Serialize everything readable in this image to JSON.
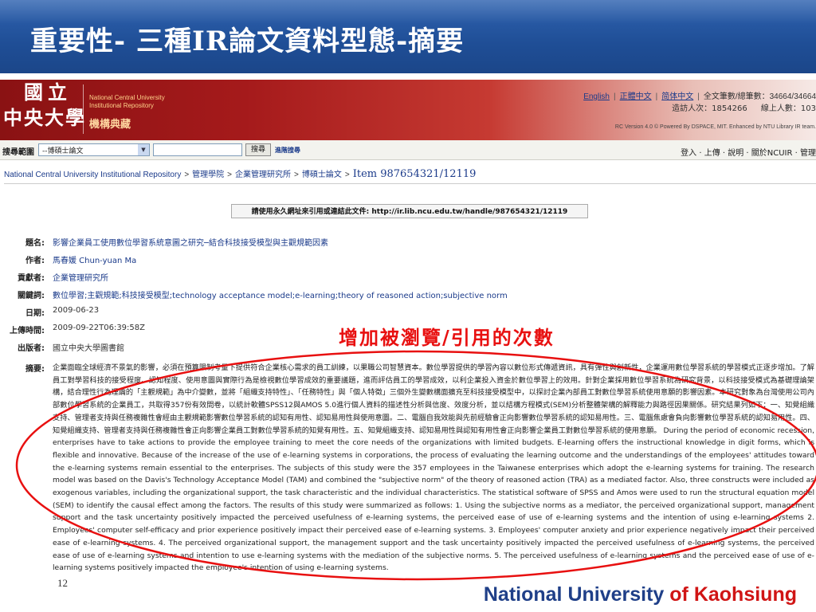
{
  "slide": {
    "title": "重要性- 三種IR論文資料型態-摘要",
    "annotation": "增加被瀏覽/引用的次數",
    "page_number": "12",
    "footer_part1": "National University",
    "footer_part2": "of Kaohsiung"
  },
  "header": {
    "logo_line1": "國立",
    "logo_line2": "中央大學",
    "logo_en1": "National Central University",
    "logo_en2": "Institutional Repository",
    "logo_sub": "機構典藏",
    "lang_english": "English",
    "lang_trad": "正體中文",
    "lang_simp": "简体中文",
    "stats_text": "全文筆數/總筆數：34664/34664",
    "visitors": "造訪人次：1854266",
    "online": "線上人數：103",
    "version": "RC Version 4.0 © Powered By DSPACE, MIT. Enhanced by NTU Library IR team."
  },
  "search": {
    "label": "搜尋範圍",
    "scope": "--博碩士論文",
    "button": "搜尋",
    "advanced": "進階搜尋",
    "right_links": "登入 · 上傳 · 說明 · 關於NCUIR · 管理"
  },
  "breadcrumb": {
    "repo": "National Central University Institutional Repository",
    "c1": "管理學院",
    "c2": "企業管理研究所",
    "c3": "博碩士論文",
    "item": "Item 987654321/12119"
  },
  "permalink": "請使用永久網址來引用或連結此文件: http://ir.lib.ncu.edu.tw/handle/987654321/12119",
  "record": {
    "title_label": "題名:",
    "title_value": "影響企業員工使用數位學習系統意圖之研究─結合科技接受模型與主觀規範因素",
    "author_label": "作者:",
    "author_value": "馬春媛 Chun-yuan Ma",
    "contrib_label": "貢獻者:",
    "contrib_value": "企業管理研究所",
    "keywords_label": "關鍵詞:",
    "keywords_value": "數位學習;主觀規範;科技接受模型;technology acceptance model;e-learning;theory of reasoned action;subjective norm",
    "date_label": "日期:",
    "date_value": "2009-06-23",
    "upload_label": "上傳時間:",
    "upload_value": "2009-09-22T06:39:58Z",
    "publisher_label": "出版者:",
    "publisher_value": "國立中央大學圖書館",
    "abstract_label": "摘要:",
    "abstract_value": "企業面臨全球經濟不景氣的影響，必須在預算限制考量下提供符合企業核心需求的員工訓練，以果職公司智慧資本。數位學習提供的學習內容以數位形式傳遞資訊，具有彈性與創新性，企業運用數位學習系統的學習模式正逐步增加。了解員工對學習科技的接受程度、認知程度、使用意圖與實際行為是檢視數位學習成效的重要議題，進而評估員工的學習成效，以利企業投入資金於數位學習上的效用。針對企業採用數位學習系統為研究背景，以科技接受模式為基礎理論架構，結合理性行為理論的「主觀規範」為中介變數，並將「組織支持特性」、「任務特性」與「個人特徵」三個外生變數構面擴充至科技接受模型中，以探討企業內部員工對數位學習系統使用意願的影響因素。本研究對象為台灣使用公司內部數位學習系統的企業員工，共取得357份有效問卷，以統計軟體SPSS12與AMOS 5.0進行個人資料的描述性分析與信度、效度分析，並以結構方程模式(SEM)分析整體架構的解釋能力與路徑因果關係。研究結果列如下：一、知覺組織支持、管理者支持與任務複雜性會經由主觀規範影響數位學習系統的認知有用性、認知易用性與使用意圖。二、電腦自我效能與先前經驗會正向影響數位學習系統的認知易用性。三、電腦焦慮會負向影響數位學習系統的認知易用性。四、知覺組織支持、管理者支持與任務複雜性會正向影響企業員工對數位學習系統的知覺有用性。五、知覺組織支持、認知易用性與認知有用性會正向影響企業員工對數位學習系統的使用意願。    During the period of economic recession, enterprises have to take actions to provide the employee training to meet the core needs of the organizations with limited budgets. E-learning offers the instructional knowledge in digit forms, which is flexible and innovative. Because of the increase of the use of e-learning systems in corporations, the process of evaluating the learning outcome and the understandings of the employees' attitudes toward the e-learning systems remain essential to the enterprises.      The subjects of this study were the 357 employees in the Taiwanese enterprises which adopt the e-learning systems for training. The research model was based on the Davis's Technology Acceptance Model (TAM) and combined the \"subjective norm\" of the theory of reasoned action (TRA) as a mediated factor. Also, three constructs were included as exogenous variables, including the organizational support, the task characteristic and the individual characteristics.      The statistical software of SPSS and Amos were used to run the structural equation model (SEM) to identify the causal effect among the factors. The results of this study were summarized as follows: 1. Using the subjective norms as a mediator, the perceived organizational support, management support and the task uncertainty positively impacted the perceived usefulness of e-learning systems, the perceived ease of use of e-learning systems and the intention of using e-learning systems 2. Employees' computer self-efficacy and prior experience positively impact their perceived ease of e-learning systems. 3. Employees' computer anxiety and prior experience negatively impact their perceived ease of e-learning systems. 4. The perceived organizational support, the management support and the task uncertainty positively impacted the perceived usefulness of e-learning systems, the perceived ease of use of e-learning systems and intention to use e-learning systems with the mediation of the subjective norms. 5. The perceived usefulness of e-learning systems and the perceived ease of use of e-learning systems positively impacted the employee's intention of using e-learning systems."
  },
  "colors": {
    "title_bar": "#1f4e96",
    "ncu_red": "#a51a1b",
    "annotation": "#e81010",
    "footer_blue": "#1f3f88",
    "footer_red": "#d01515"
  }
}
